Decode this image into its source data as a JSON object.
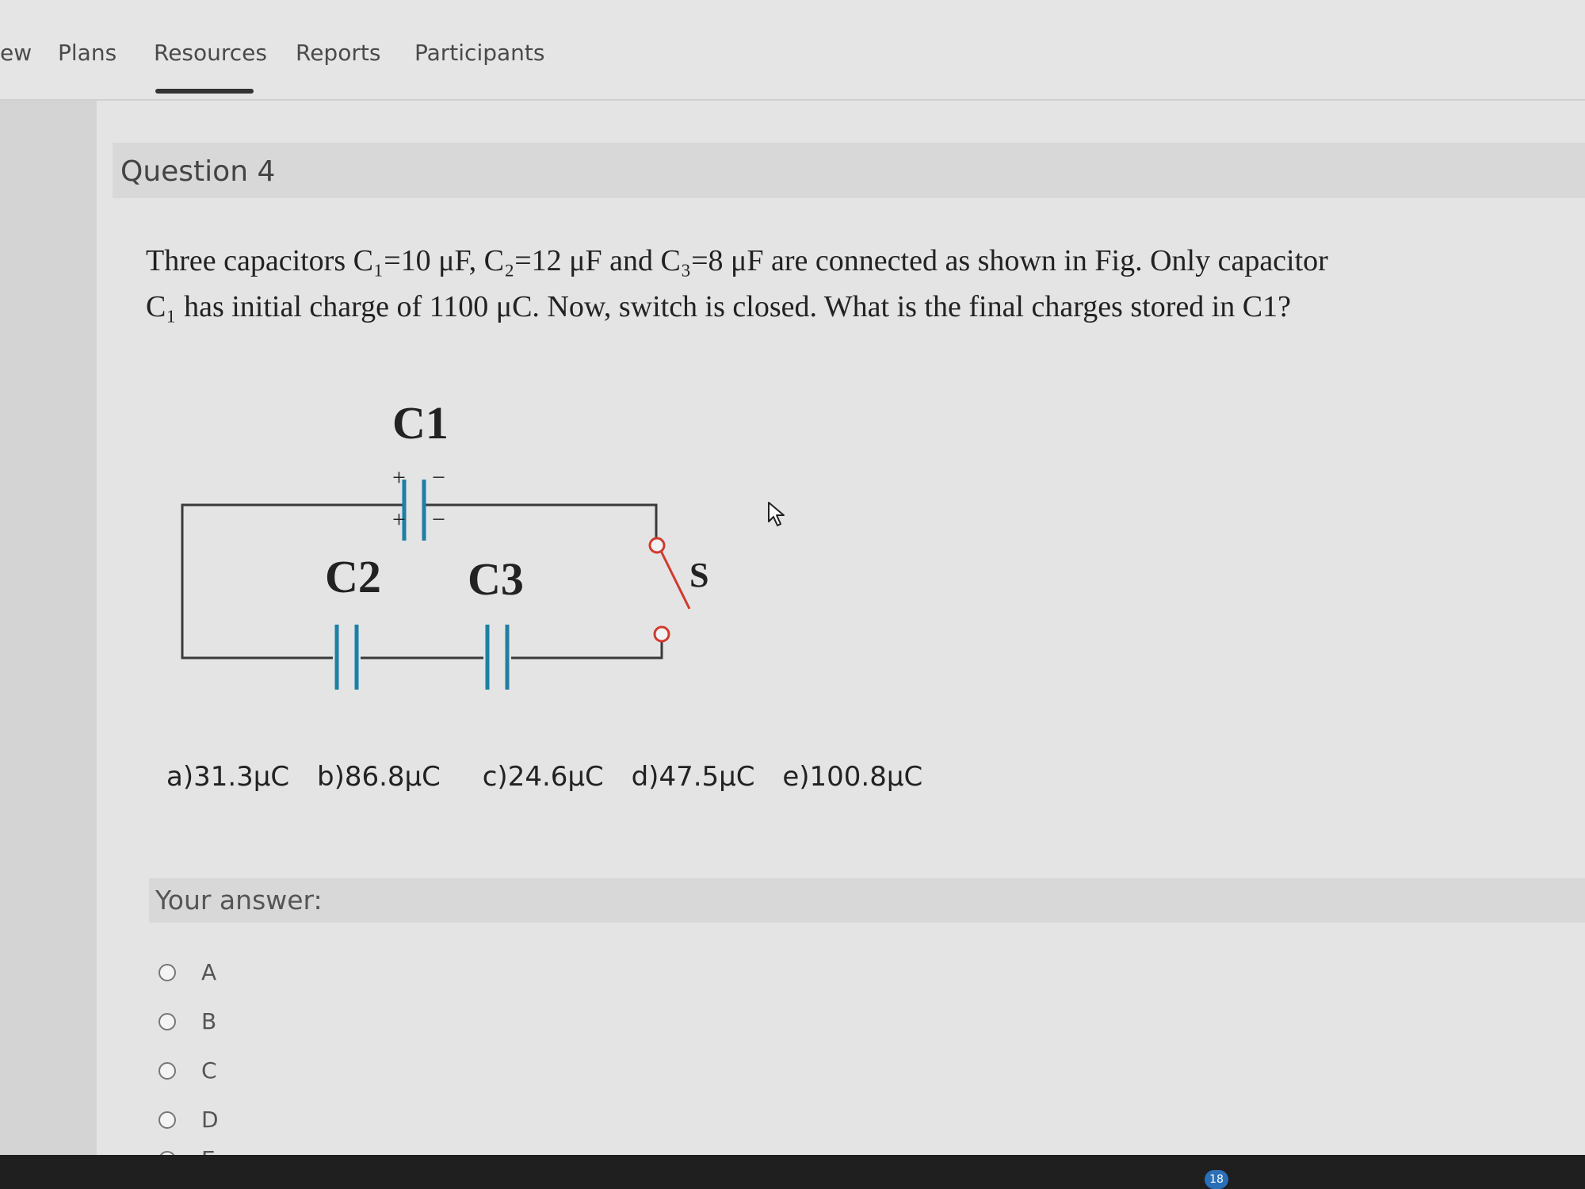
{
  "nav": {
    "items": [
      "ew",
      "Plans",
      "Resources",
      "Reports",
      "Participants"
    ],
    "active": "Resources"
  },
  "question": {
    "title": "Question 4",
    "text": "Three capacitors C₁=10 μF, C₂=12 μF and C₃=8 μF   are connected as shown in Fig. Only capacitor C₁ has initial charge of 1100 μC. Now, switch is closed. What is the final charges stored in C1?"
  },
  "figure": {
    "label_c1": "C1",
    "label_c2": "C2",
    "label_c3": "C3",
    "label_switch": "S",
    "plus_sign": "+",
    "minus_sign": "−",
    "wire_color": "#3a3a3a",
    "capacitor_color": "#1e7fa3",
    "switch_color": "#d13a2e"
  },
  "options": {
    "a": "a)31.3μC",
    "b": "b)86.8μC",
    "c": "c)24.6μC",
    "d": "d)47.5μC",
    "e": "e)100.8μC"
  },
  "answer": {
    "label": "Your answer:",
    "choices": [
      "A",
      "B",
      "C",
      "D",
      "E"
    ]
  },
  "taskbar": {
    "badge": "18"
  }
}
